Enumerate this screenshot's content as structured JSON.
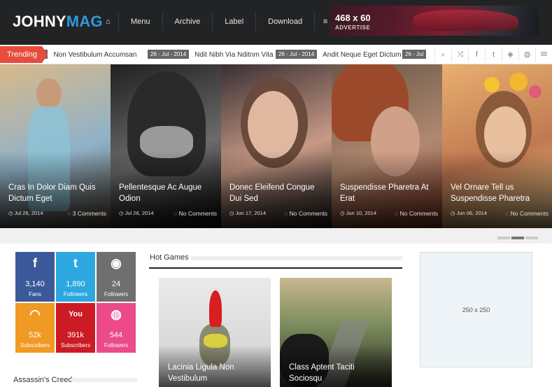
{
  "header": {
    "logo_part1": "JOHNY",
    "logo_part2": "MAG",
    "nav": [
      {
        "label": "Menu"
      },
      {
        "label": "Archive"
      },
      {
        "label": "Label"
      },
      {
        "label": "Download"
      }
    ],
    "home_icon": "⌂",
    "menu_icon": "≡",
    "ad": {
      "size": "468 x 60",
      "label": "ADVERTISE"
    }
  },
  "ticker": {
    "label": "Trending",
    "items": [
      {
        "date": "4",
        "title": "Non Vestibulum Accumsan"
      },
      {
        "date": "26 - Jul - 2014",
        "title": "Ndit Nibh Via Nditnm Vita"
      },
      {
        "date": "26 - Jul - 2014",
        "title": "Andit Neque Eget Dictum"
      },
      {
        "date": "26 - Jul",
        "title": ""
      }
    ],
    "icons": [
      "search-icon",
      "shuffle-icon",
      "facebook-icon",
      "twitter-icon",
      "rss-icon",
      "dribbble-icon",
      "mail-icon"
    ],
    "icon_glyphs": [
      "⌕",
      "⤨",
      "f",
      "t",
      "◈",
      "◍",
      "✉"
    ]
  },
  "slider": [
    {
      "title": "Cras In Dolor Diam Quis Dictum Eget",
      "date": "Jul 26, 2014",
      "comments": "3 Comments",
      "colors": [
        "#d9b98a",
        "#8fb2c9",
        "#5b4a3a"
      ]
    },
    {
      "title": "Pellentesque Ac Augue Odion",
      "date": "Jul 26, 2014",
      "comments": "No Comments",
      "colors": [
        "#202020",
        "#6b6b6b",
        "#0d0d0d"
      ]
    },
    {
      "title": "Donec Eleifend Congue Dui Sed",
      "date": "Jun 17, 2014",
      "comments": "No Comments",
      "colors": [
        "#3a3033",
        "#c89a86",
        "#23201f"
      ]
    },
    {
      "title": "Suspendisse Pharetra At Erat",
      "date": "Jun 10, 2014",
      "comments": "No Comments",
      "colors": [
        "#6a5a48",
        "#b08870",
        "#8a3a22"
      ]
    },
    {
      "title": "Vel Ornare Tell us Suspendisse Pharetra",
      "date": "Jun 06, 2014",
      "comments": "No Comments",
      "colors": [
        "#e8b070",
        "#c07850",
        "#f0d090"
      ]
    }
  ],
  "social": [
    {
      "name": "facebook-icon",
      "icon": "f",
      "count": "3,140",
      "label": "Fans",
      "color": "#3b5998"
    },
    {
      "name": "twitter-icon",
      "icon": "t",
      "count": "1,890",
      "label": "Followers",
      "color": "#2ca7e0"
    },
    {
      "name": "github-icon",
      "icon": "◉",
      "count": "24",
      "label": "Followers",
      "color": "#6f6f6f"
    },
    {
      "name": "rss-icon",
      "icon": "◠",
      "count": "52k",
      "label": "Subscribers",
      "color": "#f09a23"
    },
    {
      "name": "youtube-icon",
      "icon": "You",
      "count": "391k",
      "label": "Subscribers",
      "color": "#cc1b24"
    },
    {
      "name": "dribbble-icon",
      "icon": "◍",
      "count": "544",
      "label": "Followers",
      "color": "#ec4a89"
    }
  ],
  "hot_games": {
    "title": "Hot Games",
    "cards": [
      {
        "title": "Lacinia Ligula Non Vestibulum"
      },
      {
        "title": "Class Aptent Taciti Sociosqu"
      }
    ]
  },
  "sidebar_ad": {
    "label": "250 x 250"
  },
  "assassins": {
    "title": "Assassin's Creed"
  }
}
